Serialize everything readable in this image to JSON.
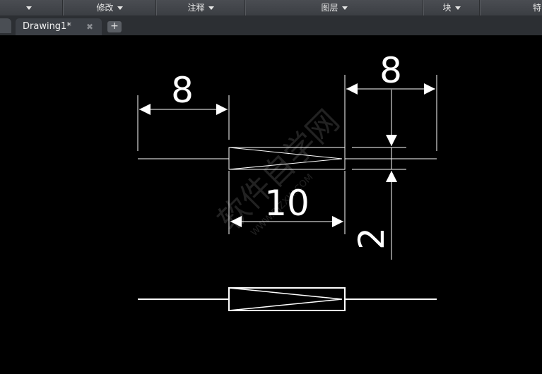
{
  "ribbon": {
    "items": [
      {
        "label": ""
      },
      {
        "label": "修改"
      },
      {
        "label": "注释"
      },
      {
        "label": "图层"
      },
      {
        "label": "块"
      },
      {
        "label": "特"
      }
    ]
  },
  "tabs": {
    "active_label": "Drawing1*",
    "close_glyph": "✖",
    "add_glyph": "+"
  },
  "drawing": {
    "dim_left": "8",
    "dim_right": "8",
    "dim_length": "10",
    "dim_height": "2",
    "watermark_cn": "软件自学网",
    "watermark_url": "WWW.RJZXW.COM",
    "line_color": "#ffffff"
  },
  "icons": [
    "chevron-down-icon",
    "close-icon",
    "plus-icon"
  ]
}
